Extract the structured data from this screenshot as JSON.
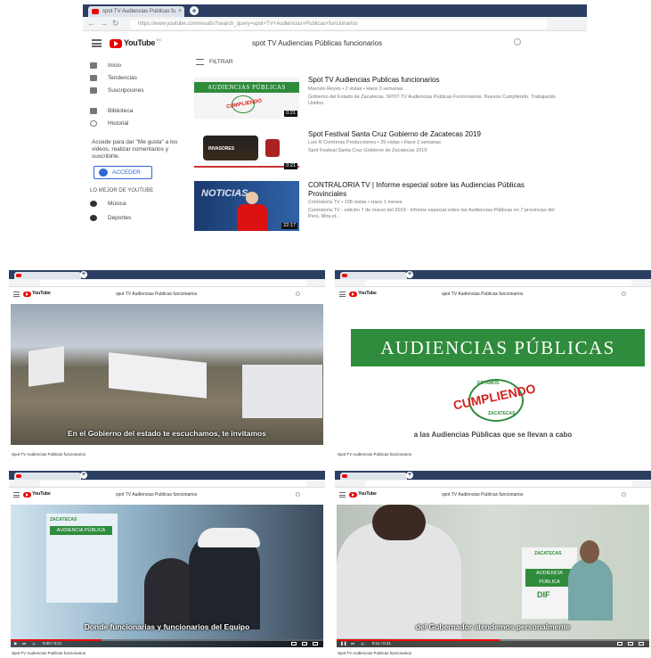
{
  "main": {
    "tab_title": "spot TV Audiencias Publicas fu",
    "url": "https://www.youtube.com/results?search_query=spot+TV+Audiencias+Publicas+funcionarios",
    "brand": "YouTube",
    "brand_sup": "MX",
    "search_query": "spot TV Audiencias Públicas funcionarios",
    "sidebar": {
      "items": [
        "Inicio",
        "Tendencias",
        "Suscripciones",
        "Biblioteca",
        "Historial"
      ],
      "signin_text": "Accede para dar \"Me gusta\" a los videos, realizar comentarios y suscribirte.",
      "signin_button": "ACCEDER",
      "best_of": "LO MEJOR DE YOUTUBE",
      "best_items": [
        "Música",
        "Deportes"
      ]
    },
    "filter_label": "FILTRAR",
    "results": [
      {
        "title": "Spot TV Audiencias Publicas funcionarios",
        "meta": "Marcelo Reyes • 2 vistas • Hace 3 semanas",
        "desc": "Gobierno del Estado de Zacatecas. SPOT TV Audiencias Publicas Funcionarios. Nuevos Cumpliendo. Trabajando Unidos.",
        "duration": "0:21",
        "thumb_banner": "AUDIENCIAS PÚBLICAS",
        "thumb_stamp": "CUMPLIENDO"
      },
      {
        "title": "Spot Festival Santa Cruz Gobierno de Zacatecas 2019",
        "meta": "Luis R Contreras Producciones • 29 vistas • Hace 2 semanas",
        "desc": "Spot Festival Santa Cruz Gobierno de Zacatecas 2019",
        "duration": "0:21",
        "thumb_label": "INVASORES"
      },
      {
        "title": "CONTRALORIA TV | Informe especial sobre las Audiencias Públicas",
        "title2": "Provinciales",
        "meta": "Contraloría TV • 198 vistas • Hace 1 meses",
        "desc": "Contraloría TV - edición 7 de marzo del 2019 - Informe especial sobre las Audiencias Públicas en 7 provincias del Perú. Mira el...",
        "duration": "22:17",
        "thumb_label": "NOTICIAS"
      }
    ]
  },
  "shots": [
    {
      "search_query": "spot TV Audiencias Publicas funcionarios",
      "subtitle": "En el Gobierno del estado te escuchamos, te invitamos",
      "video_title": "Spot TV Audiencias Publicas funcionarios"
    },
    {
      "search_query": "spot TV Audiencias Publicas funcionarios",
      "banner": "AUDIENCIAS PÚBLICAS",
      "stamp_top": "ESTAMOS",
      "stamp": "CUMPLIENDO",
      "stamp_bottom": "ZACATECAS",
      "subtitle": "a las Audiencias Públicas que se llevan a cabo",
      "video_title": "Spot TV Audiencias Publicas funcionarios"
    },
    {
      "search_query": "spot TV Audiencias Publicas funcionarios",
      "subtitle": "Donde funcionarias y funcionarios del Equipo",
      "video_title": "Spot TV Audiencias Publicas funcionarios",
      "poster_title": "AUDIENCIA PÚBLICA",
      "poster_brand": "ZACATECAS",
      "time": "0:06 / 0:21"
    },
    {
      "search_query": "spot TV Audiencias Publicas funcionarios",
      "subtitle": "del Gobernador atendemos personalmente",
      "video_title": "Spot TV Audiencias Publicas funcionarios",
      "poster_title": "AUDIENCIA PÚBLICA",
      "poster_brand": "DIF",
      "time": "0:11 / 0:21"
    }
  ]
}
